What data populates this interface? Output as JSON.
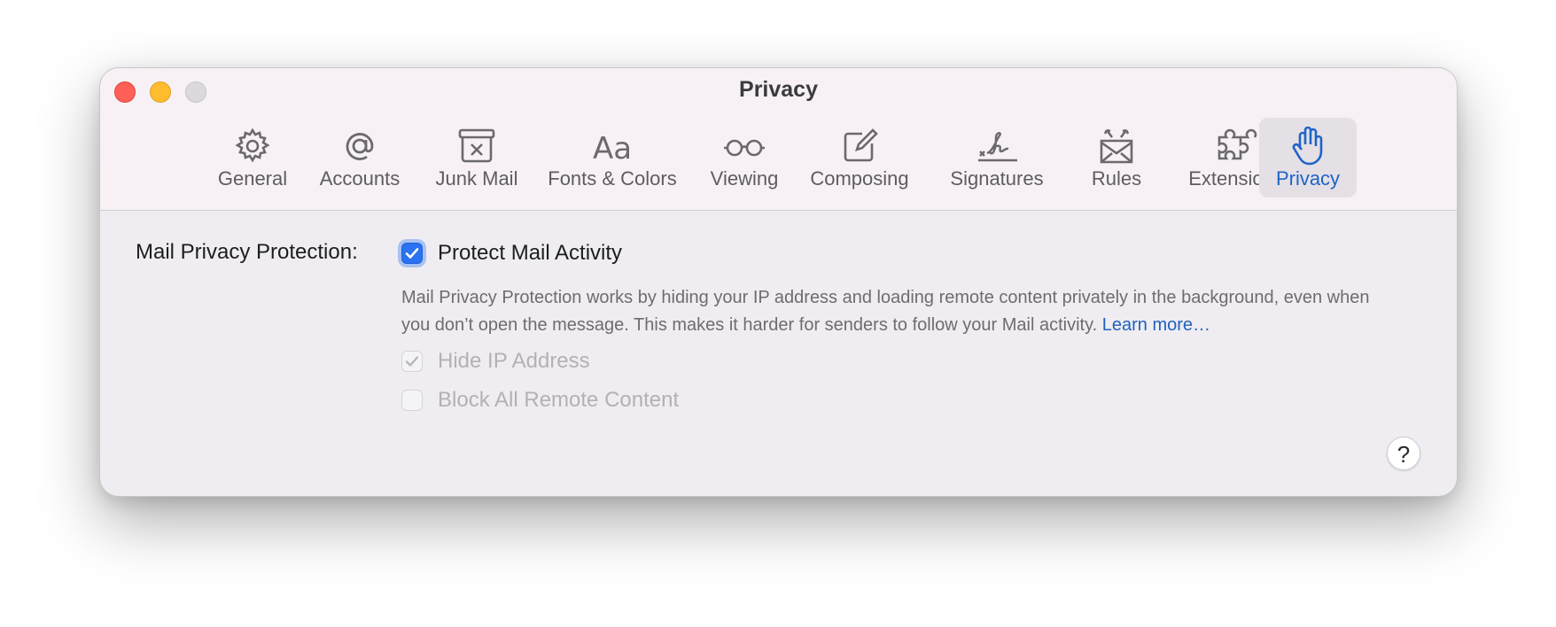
{
  "window": {
    "title": "Privacy"
  },
  "tabs": [
    {
      "label": "General",
      "icon": "gear-icon",
      "selected": false
    },
    {
      "label": "Accounts",
      "icon": "at-icon",
      "selected": false
    },
    {
      "label": "Junk Mail",
      "icon": "junk-mail-icon",
      "selected": false
    },
    {
      "label": "Fonts & Colors",
      "icon": "fonts-icon",
      "selected": false
    },
    {
      "label": "Viewing",
      "icon": "glasses-icon",
      "selected": false
    },
    {
      "label": "Composing",
      "icon": "compose-icon",
      "selected": false
    },
    {
      "label": "Signatures",
      "icon": "signature-icon",
      "selected": false
    },
    {
      "label": "Rules",
      "icon": "rules-envelope-icon",
      "selected": false
    },
    {
      "label": "Extensions",
      "icon": "puzzle-icon",
      "selected": false
    },
    {
      "label": "Privacy",
      "icon": "hand-icon",
      "selected": true
    }
  ],
  "privacy": {
    "section_label": "Mail Privacy Protection:",
    "protect": {
      "label": "Protect Mail Activity",
      "checked": true
    },
    "description": "Mail Privacy Protection works by hiding your IP address and loading remote content privately in the background, even when you don’t open the message. This makes it harder for senders to follow your Mail activity.",
    "learn_more": "Learn more…",
    "hide_ip": {
      "label": "Hide IP Address",
      "checked": true,
      "disabled": true
    },
    "block_remote": {
      "label": "Block All Remote Content",
      "checked": false,
      "disabled": true
    }
  },
  "help_button": "?",
  "colors": {
    "accent": "#2a72f0",
    "selected_tab_label": "#1f64c8",
    "link": "#2060c0"
  }
}
